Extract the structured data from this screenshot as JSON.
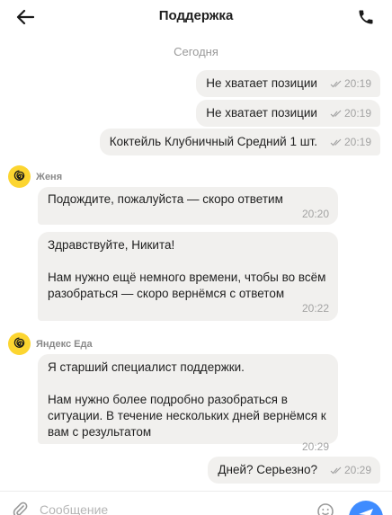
{
  "header": {
    "title": "Поддержка",
    "back_icon": "arrow-left-icon",
    "call_icon": "phone-icon"
  },
  "chat": {
    "day_separator": "Сегодня",
    "outgoing_top": [
      {
        "text": "Не хватает позиции",
        "time": "20:19",
        "status_icon": "double-check-icon"
      },
      {
        "text": "Не хватает позиции",
        "time": "20:19",
        "status_icon": "double-check-icon"
      },
      {
        "text": "Коктейль Клубничный Средний 1 шт.",
        "time": "20:19",
        "status_icon": "double-check-icon"
      }
    ],
    "group1": {
      "sender": "Женя",
      "messages": [
        {
          "text": "Подождите, пожалуйста — скоро ответим",
          "time": "20:20"
        },
        {
          "text": "Здравствуйте, Никита!\n\nНам нужно ещё немного времени, чтобы во всём разобраться — скоро вернёмся с ответом",
          "time": "20:22"
        }
      ]
    },
    "group2": {
      "sender": "Яндекс Еда",
      "messages": [
        {
          "text": "Я старший специалист поддержки.\n\nНам нужно более подробно разобраться в ситуации. В течение нескольких дней вернёмся к вам с результатом",
          "time": "20:29"
        }
      ]
    },
    "outgoing_last": {
      "text": "Дней? Серьезно?",
      "time": "20:29",
      "status_icon": "double-check-icon"
    }
  },
  "composer": {
    "placeholder": "Сообщение",
    "attach_icon": "paperclip-icon",
    "emoji_icon": "smile-icon",
    "send_icon": "send-arrow-icon"
  },
  "colors": {
    "bubble": "#f1f0ee",
    "avatar": "#fcd530",
    "send_button": "#3f8cff",
    "meta_text": "#a3a3a3"
  }
}
